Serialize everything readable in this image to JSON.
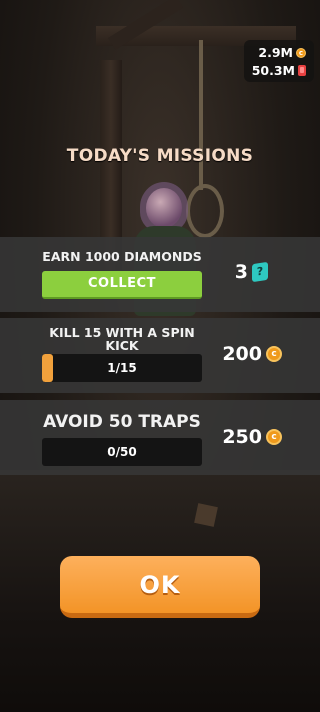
{
  "currency": {
    "coins": "2.9M",
    "coin_icon": "coin-icon",
    "gems": "50.3M",
    "gem_icon": "red-gem-icon"
  },
  "title": "TODAY'S MISSIONS",
  "missions": [
    {
      "label": "EARN 1000 DIAMONDS",
      "action_label": "COLLECT",
      "reward": "3",
      "reward_icon": "diamond-icon",
      "reward_icon_glyph": "?"
    },
    {
      "label": "KILL 15 WITH A SPIN KICK",
      "progress": "1/15",
      "progress_fraction": 0.0667,
      "reward": "200",
      "reward_icon": "coin-icon"
    },
    {
      "label": "AVOID 50 TRAPS",
      "progress": "0/50",
      "progress_fraction": 0,
      "reward": "250",
      "reward_icon": "coin-icon"
    }
  ],
  "ok_label": "OK",
  "colors": {
    "accent_orange": "#f39427",
    "collect_green": "#8ccf3e",
    "title_color": "#f6dbc6",
    "diamond_teal": "#2ec9c1",
    "gem_red": "#e84141"
  }
}
